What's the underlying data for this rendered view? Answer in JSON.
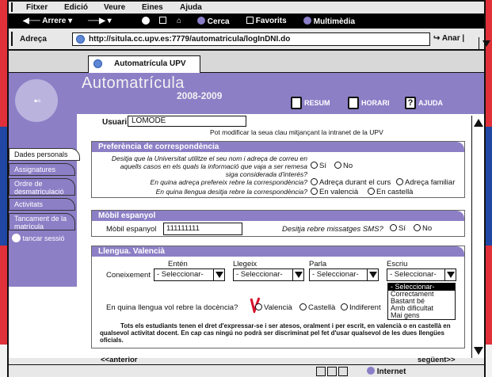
{
  "menu": [
    "Fitxer",
    "Edició",
    "Veure",
    "Eines",
    "Ajuda"
  ],
  "nav": {
    "back": "Arrere",
    "search": "Cerca",
    "favorites": "Favorits",
    "multimedia": "Multimèdia"
  },
  "address": {
    "label": "Adreça",
    "url": "http://situla.cc.upv.es:7779/automatricula/logInDNI.do",
    "go": "Anar"
  },
  "tab_title": "Automatrícula UPV",
  "header": {
    "title": "Automatrícula",
    "years": "2008-2009",
    "resum": "RESUM",
    "horari": "HORARI",
    "ajuda": "AJUDA"
  },
  "sidebar": {
    "items": [
      {
        "label": "Dades personals"
      },
      {
        "label": "Assignatures"
      },
      {
        "label": "Ordre de desmatriculació"
      },
      {
        "label": "Activitats"
      },
      {
        "label": "Tancament de la matrícula"
      }
    ],
    "logout": "tancar sessió"
  },
  "user": {
    "label": "Usuari",
    "value": "LOMODE",
    "note": "Pot modificar la seua clau mitjançant la intranet de la UPV"
  },
  "correspondence": {
    "title": "Preferència de correspondència",
    "q1": "Desitja que la Universitat utilitze el seu nom i adreça de correu en aquells casos en els quals la informació que vaja a ser remesa siga considerada d'interés?",
    "q1_yes": "Sí",
    "q1_no": "No",
    "q2": "En quina adreça prefereix rebre la correspondència?",
    "q2_a": "Adreça durant el curs",
    "q2_b": "Adreça familiar",
    "q3": "En quina llengua desitja rebre la correspondència?",
    "q3_a": "En valencià",
    "q3_b": "En castellà"
  },
  "mobile": {
    "title": "Mòbil espanyol",
    "label": "Mòbil espanyol",
    "value": "111111111",
    "sms_q": "Desitja rebre missatges SMS?",
    "yes": "Sí",
    "no": "No"
  },
  "language": {
    "title": "Llengua. Valencià",
    "row_label": "Coneixement",
    "cols": [
      "Entén",
      "Llegeix",
      "Parla",
      "Escriu"
    ],
    "select_value": "- Seleccionar-",
    "dropdown_options": [
      "- Seleccionar-",
      "Correctament",
      "Bastant bé",
      "Amb dificultat",
      "Mai gens"
    ],
    "teaching_q": "En quina llengua vol rebre la docència?",
    "opt_val": "Valencià",
    "opt_cas": "Castellà",
    "opt_ind": "Indiferent",
    "rights": "Tots els estudiants tenen el dret d'expressar-se i ser atesos, oralment i per escrit, en valencià o en castellà en qualsevol activitat docent. En cap cas ningú no podrà ser discriminat pel fet d'usar qualsevol de les dues llengües oficials."
  },
  "footer": {
    "prev": "<<anterior",
    "next": "següent>>",
    "zone": "Internet"
  },
  "colors": {
    "purple": "#8c7fc6",
    "red": "#e0303a",
    "blue": "#1f47a3",
    "mark": "#d8102a"
  }
}
